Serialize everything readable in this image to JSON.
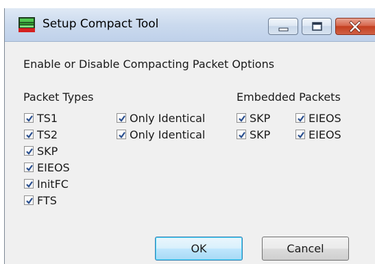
{
  "window": {
    "title": "Setup Compact Tool"
  },
  "heading": "Enable or Disable Compacting Packet Options",
  "packet_types": {
    "label": "Packet Types",
    "items": [
      {
        "label": "TS1",
        "checked": true
      },
      {
        "label": "TS2",
        "checked": true
      },
      {
        "label": "SKP",
        "checked": true
      },
      {
        "label": "EIEOS",
        "checked": true
      },
      {
        "label": "InitFC",
        "checked": true
      },
      {
        "label": "FTS",
        "checked": true
      }
    ],
    "only_identical": [
      {
        "label": "Only Identical",
        "checked": true
      },
      {
        "label": "Only Identical",
        "checked": true
      }
    ]
  },
  "embedded_packets": {
    "label": "Embedded Packets",
    "rows": [
      {
        "skp": {
          "label": "SKP",
          "checked": true
        },
        "eieos": {
          "label": "EIEOS",
          "checked": true
        }
      },
      {
        "skp": {
          "label": "SKP",
          "checked": true
        },
        "eieos": {
          "label": "EIEOS",
          "checked": true
        }
      }
    ]
  },
  "buttons": {
    "ok": "OK",
    "cancel": "Cancel"
  },
  "icons": {
    "app": "compact-tool-icon",
    "minimize": "minimize-icon",
    "maximize": "maximize-icon",
    "close": "close-icon",
    "checkmark": "checkmark-icon"
  },
  "colors": {
    "dialog_bg": "#f0f0f0",
    "titlebar": "#cbdaee",
    "close_button": "#c43f1f",
    "checkmark": "#2a4f8f",
    "default_button_border": "#3c7fb1"
  }
}
